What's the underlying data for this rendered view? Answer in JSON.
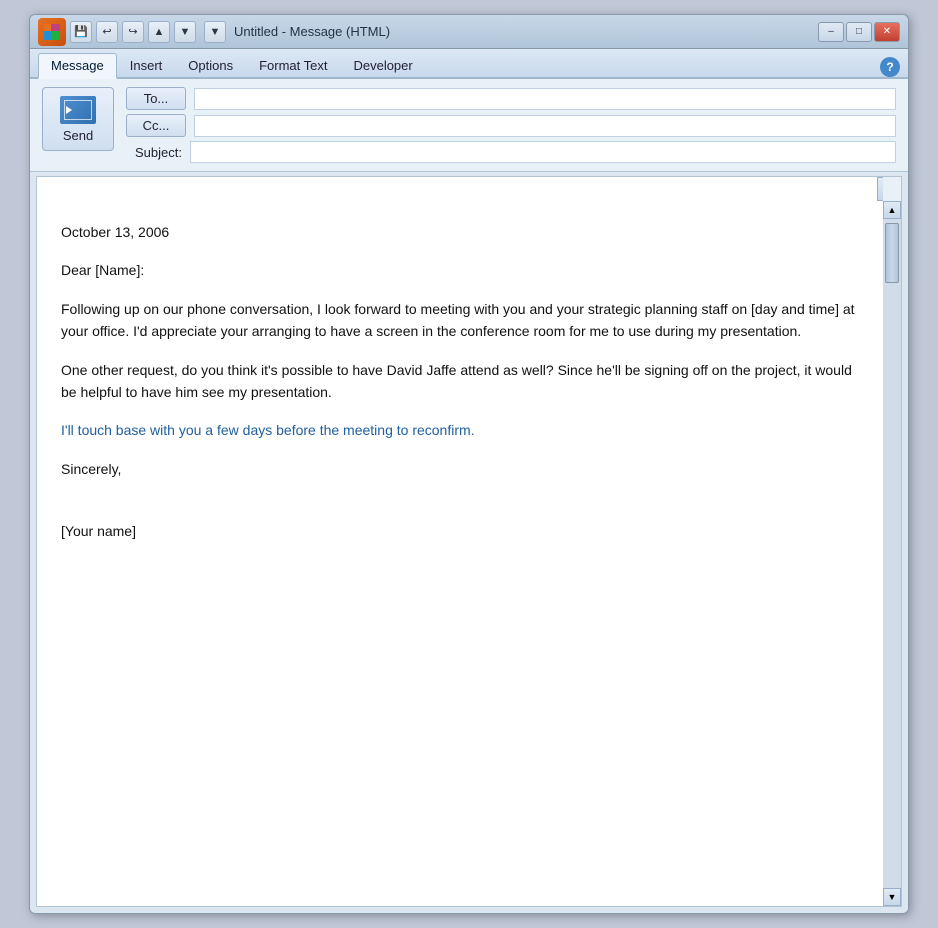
{
  "window": {
    "title": "Untitled - Message (HTML)",
    "app_icon_text": "O"
  },
  "titlebar": {
    "save_icon": "💾",
    "undo_icon": "↩",
    "redo_icon": "↪",
    "up_icon": "▲",
    "down_icon": "▼",
    "pin_icon": "▼",
    "minimize_label": "–",
    "restore_label": "□",
    "close_label": "✕"
  },
  "tabs": {
    "items": [
      {
        "label": "Message",
        "active": true
      },
      {
        "label": "Insert",
        "active": false
      },
      {
        "label": "Options",
        "active": false
      },
      {
        "label": "Format Text",
        "active": false
      },
      {
        "label": "Developer",
        "active": false
      }
    ]
  },
  "email": {
    "to_label": "To...",
    "cc_label": "Cc...",
    "subject_label": "Subject:",
    "send_label": "Send",
    "to_value": "",
    "cc_value": "",
    "subject_value": ""
  },
  "body": {
    "date": "October 13, 2006",
    "greeting": "Dear [Name]:",
    "paragraph1": "Following up on our phone conversation, I look forward to meeting with you and your strategic planning staff on [day and time] at your office. I'd appreciate your arranging to have a screen in the conference room for me to use during my presentation.",
    "paragraph2": "One other request, do you think it's possible to have David Jaffe attend as well? Since he'll be signing off on the project, it would be helpful to have him see my presentation.",
    "paragraph3": "I'll touch base with you a few days before the meeting to reconfirm.",
    "closing": "Sincerely,",
    "signature": "[Your name]"
  },
  "help": {
    "label": "?"
  }
}
